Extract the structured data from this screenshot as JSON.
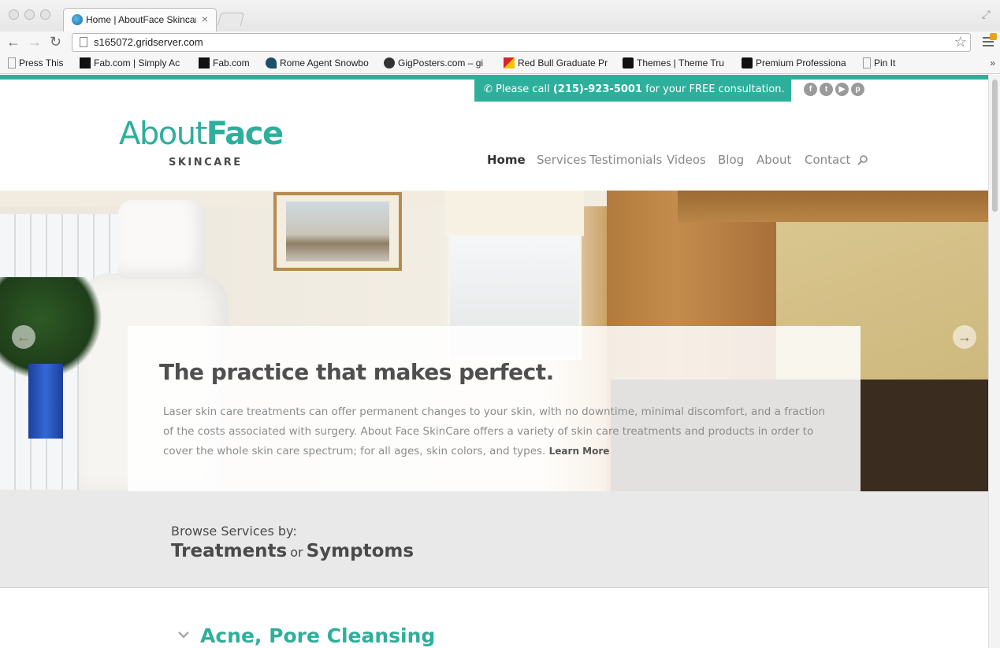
{
  "browser": {
    "tab_title": "Home | AboutFace Skincare",
    "url": "s165072.gridserver.com",
    "bookmarks": [
      "Press This",
      "Fab.com | Simply Ac",
      "Fab.com",
      "Rome Agent Snowbo",
      "GigPosters.com – gi",
      "Red Bull Graduate Pr",
      "Themes | Theme Tru",
      "Premium Professiona",
      "Pin It"
    ],
    "more": "»"
  },
  "site": {
    "accent_color": "#2eaf9c",
    "call_prefix": "Please call ",
    "phone": "(215)-923-5001",
    "call_suffix": " for your FREE consultation.",
    "social_icons": [
      "facebook-icon",
      "twitter-icon",
      "youtube-icon",
      "pinterest-icon"
    ],
    "logo_about": "About",
    "logo_face": "Face",
    "logo_sub": "SKINCARE",
    "nav": [
      "Home",
      "Services",
      "Testimonials",
      "Videos",
      "Blog",
      "About",
      "Contact"
    ]
  },
  "hero": {
    "title": "The practice that makes perfect.",
    "body": "Laser skin care treatments can offer permanent changes to your skin, with no downtime, minimal discomfort, and a fraction of the costs associated with surgery. About Face SkinCare offers a variety of skin care treatments and products in order to cover the whole skin care spectrum; for all ages, skin colors, and types. ",
    "learn_more": "Learn More"
  },
  "browse": {
    "label": "Browse Services by:",
    "treatments": "Treatments",
    "or": "or",
    "symptoms": "Symptoms"
  },
  "section": {
    "title": "Acne, Pore Cleansing"
  }
}
